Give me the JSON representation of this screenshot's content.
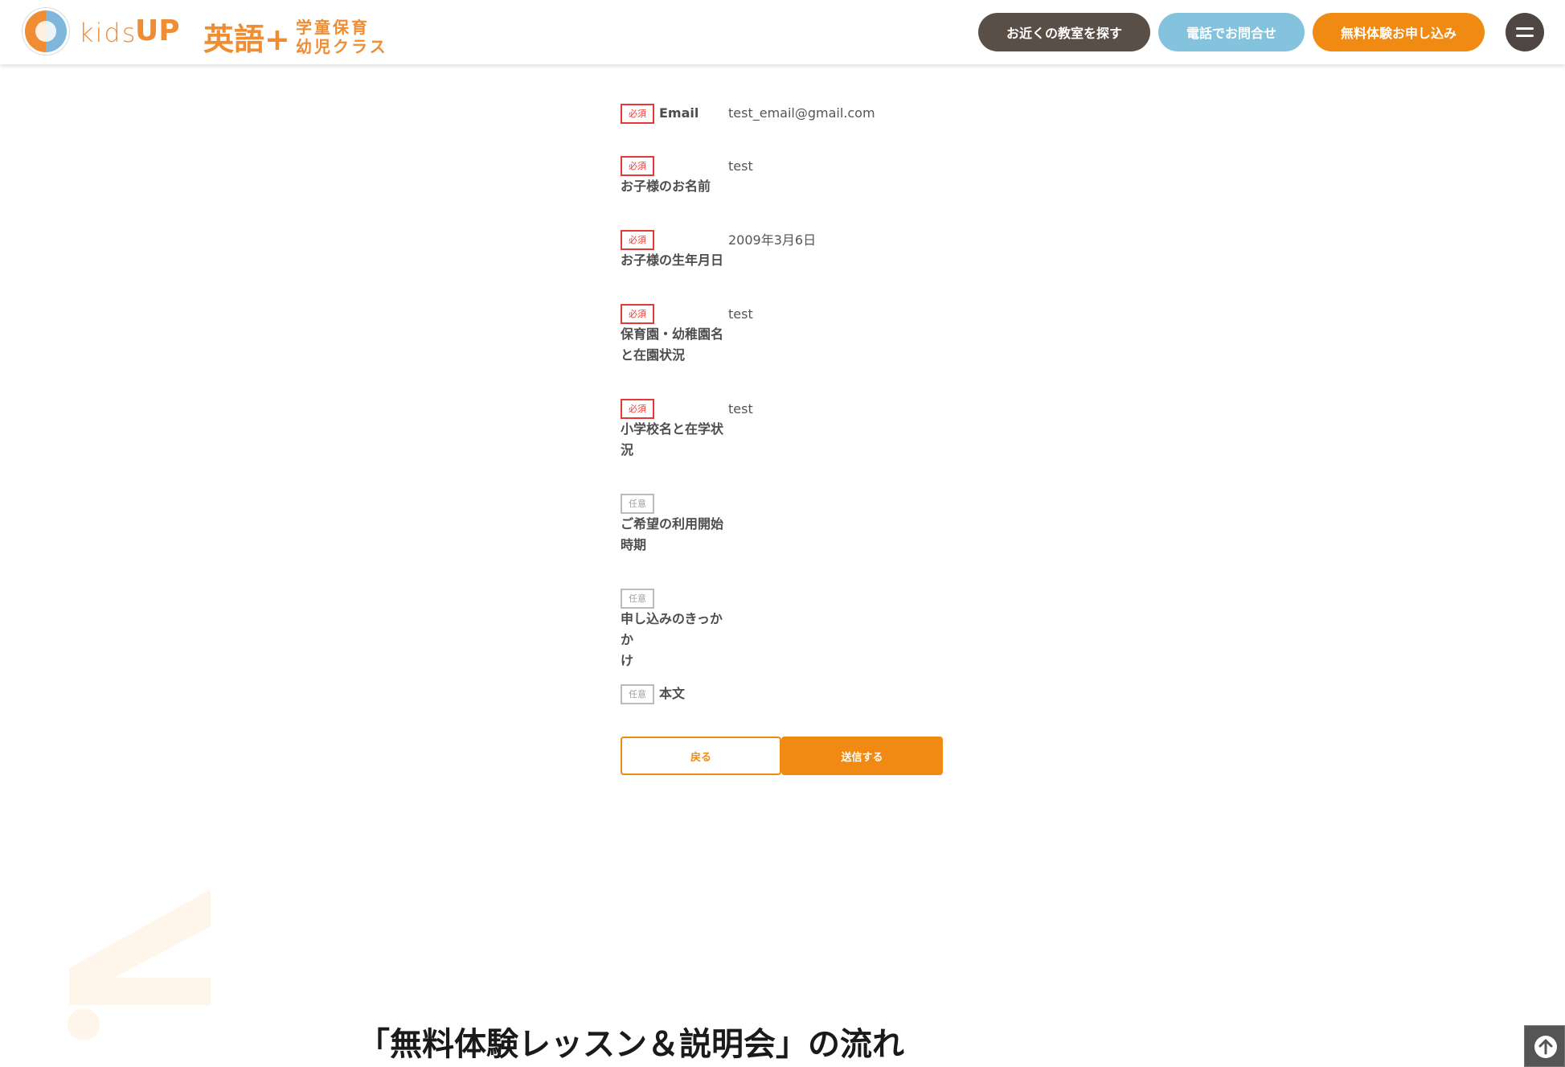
{
  "header": {
    "logo_kids": "kids",
    "logo_up": "UP",
    "logo_eigo": "英語+",
    "logo_sub1": "学童保育",
    "logo_sub2": "幼児クラス",
    "btn_find": "お近くの教室を探す",
    "btn_phone": "電話でお問合せ",
    "btn_trial": "無料体験お申し込み"
  },
  "badges": {
    "required": "必須",
    "optional": "任意"
  },
  "fields": [
    {
      "label": "Email",
      "value": "test_email@gmail.com"
    },
    {
      "label": "お子様のお名前",
      "value": "test"
    },
    {
      "label": "お子様の生年月日",
      "value": "2009年3月6日"
    },
    {
      "label_line1": "保育園・幼稚園名",
      "label_line2": "と在園状況",
      "value": "test"
    },
    {
      "label_line1": "小学校名と在学状",
      "label_line2": "況",
      "value": "test"
    },
    {
      "label_line1": "ご希望の利用開始",
      "label_line2": "時期",
      "value": ""
    },
    {
      "label_line1": "申し込みのきっかか",
      "label_line2": "け",
      "value": ""
    },
    {
      "label": "本文",
      "value": ""
    }
  ],
  "buttons": {
    "back": "戻る",
    "submit": "送信する"
  },
  "section": {
    "title": "「無料体験レッスン＆説明会」の流れ"
  },
  "colors": {
    "accent_orange": "#f08a12",
    "phone_blue": "#84c3dd",
    "dark_brown": "#5a4f47",
    "required_red": "#e53935"
  }
}
